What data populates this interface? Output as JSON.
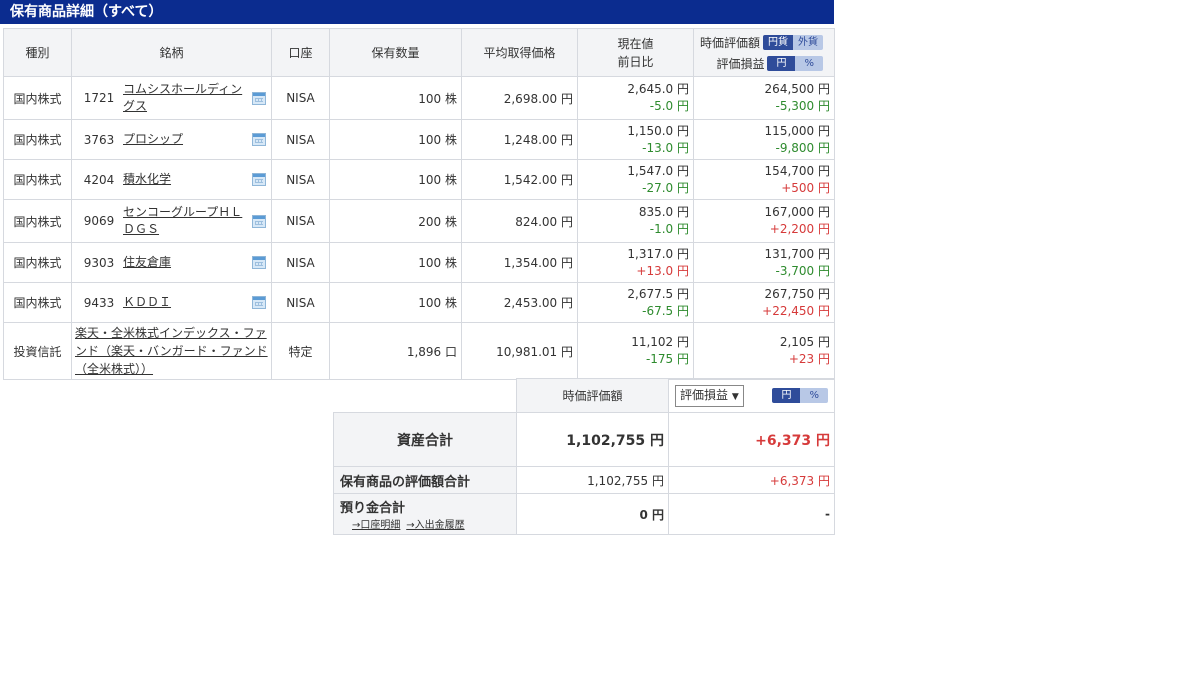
{
  "title": "保有商品詳細（すべて）",
  "headers": {
    "type": "種別",
    "name": "銘柄",
    "account": "口座",
    "quantity": "保有数量",
    "avg_price": "平均取得価格",
    "current_line1": "現在値",
    "current_line2": "前日比",
    "valuation_label": "時価評価額",
    "valuation_toggle": [
      "円貨",
      "外貨"
    ],
    "pl_label": "評価損益",
    "pl_toggle": [
      "円",
      "%"
    ]
  },
  "rows": [
    {
      "type": "国内株式",
      "code": "1721",
      "name": "コムシスホールディングス",
      "account": "NISA",
      "quantity": "100 株",
      "avg_price": "2,698.00 円",
      "price": "2,645.0 円",
      "change": "-5.0 円",
      "value": "264,500 円",
      "pl": "-5,300 円"
    },
    {
      "type": "国内株式",
      "code": "3763",
      "name": "プロシップ",
      "account": "NISA",
      "quantity": "100 株",
      "avg_price": "1,248.00 円",
      "price": "1,150.0 円",
      "change": "-13.0 円",
      "value": "115,000 円",
      "pl": "-9,800 円"
    },
    {
      "type": "国内株式",
      "code": "4204",
      "name": "積水化学",
      "account": "NISA",
      "quantity": "100 株",
      "avg_price": "1,542.00 円",
      "price": "1,547.0 円",
      "change": "-27.0 円",
      "value": "154,700 円",
      "pl": "+500 円"
    },
    {
      "type": "国内株式",
      "code": "9069",
      "name": "センコーグループＨＬＤＧＳ",
      "account": "NISA",
      "quantity": "200 株",
      "avg_price": "824.00 円",
      "price": "835.0 円",
      "change": "-1.0 円",
      "value": "167,000 円",
      "pl": "+2,200 円"
    },
    {
      "type": "国内株式",
      "code": "9303",
      "name": "住友倉庫",
      "account": "NISA",
      "quantity": "100 株",
      "avg_price": "1,354.00 円",
      "price": "1,317.0 円",
      "change": "+13.0 円",
      "value": "131,700 円",
      "pl": "-3,700 円"
    },
    {
      "type": "国内株式",
      "code": "9433",
      "name": "ＫＤＤＩ",
      "account": "NISA",
      "quantity": "100 株",
      "avg_price": "2,453.00 円",
      "price": "2,677.5 円",
      "change": "-67.5 円",
      "value": "267,750 円",
      "pl": "+22,450 円"
    }
  ],
  "fund": {
    "type": "投資信託",
    "name": "楽天・全米株式インデックス・ファンド（楽天・バンガード・ファンド（全米株式））",
    "account": "特定",
    "quantity": "1,896 口",
    "avg_price": "10,981.01 円",
    "price": "11,102 円",
    "change": "-175 円",
    "value": "2,105 円",
    "pl": "+23 円"
  },
  "summary": {
    "valuation_header": "時価評価額",
    "pl_dropdown": "評価損益",
    "pl_toggle": [
      "円",
      "%"
    ],
    "total_label": "資産合計",
    "total_value": "1,102,755 円",
    "total_pl": "+6,373 円",
    "holdings_label": "保有商品の評価額合計",
    "holdings_value": "1,102,755 円",
    "holdings_pl": "+6,373 円",
    "deposit_label": "預り金合計",
    "deposit_link1": "→口座明細",
    "deposit_link2": "→入出金履歴",
    "deposit_value": "0 円",
    "deposit_pl": "-"
  },
  "colors": {
    "title_bg": "#0b2c8f",
    "negative": "#2e8b2e",
    "positive": "#d63a3a"
  }
}
